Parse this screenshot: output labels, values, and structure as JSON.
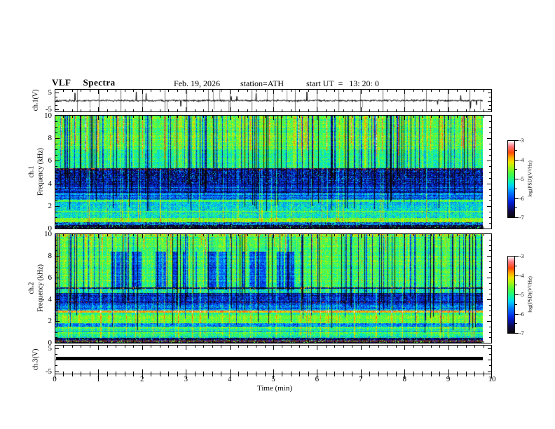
{
  "header": {
    "title": "VLF  Spectra",
    "date": "Feb. 19, 2026",
    "station": "station=ATH",
    "start_ut": "start UT  =   13: 20: 0"
  },
  "axes": {
    "time": {
      "label": "Time  (min)",
      "range_min": [
        0,
        10
      ],
      "tick_labels": [
        "0",
        "1",
        "2",
        "3",
        "4",
        "5",
        "6",
        "7",
        "8",
        "9",
        "10"
      ],
      "minor_step_min": 0.2
    },
    "frequency": {
      "unit": "kHz",
      "range_khz": [
        0,
        10
      ],
      "tick_values": [
        10,
        8,
        6,
        4,
        2,
        0
      ],
      "tick_labels": [
        "10",
        "8",
        "6",
        "4",
        "2",
        "0"
      ],
      "minor_step_khz": 0.5
    },
    "voltage": {
      "unit": "V",
      "tick_labels_top_bottom": [
        "5",
        "-5"
      ]
    }
  },
  "panels": {
    "ch1_wave": {
      "ylabel": "ch.1(V)"
    },
    "ch1_spec": {
      "ylabel_channel": "ch.1",
      "ylabel_axis": "Frequency  (kHz)"
    },
    "ch2_spec": {
      "ylabel_channel": "ch.2",
      "ylabel_axis": "Frequency  (kHz)"
    },
    "ch3_wave": {
      "ylabel": "ch.3(V)"
    }
  },
  "colorbar": {
    "label": "log(PSD)(V²/Hz)",
    "tick_labels": [
      "-3",
      "-4",
      "-5",
      "-6",
      "-7"
    ],
    "scale_range_logpsd": [
      -7,
      -3
    ]
  },
  "colormap": {
    "description": "rainbow PSD scale, t=0 maps to -7 (black) and t=1 maps to -3 (white)",
    "stops": [
      [
        0.0,
        [
          8,
          8,
          8
        ]
      ],
      [
        0.08,
        [
          15,
          8,
          70
        ]
      ],
      [
        0.2,
        [
          0,
          30,
          220
        ]
      ],
      [
        0.32,
        [
          0,
          120,
          255
        ]
      ],
      [
        0.4,
        [
          0,
          200,
          255
        ]
      ],
      [
        0.45,
        [
          0,
          235,
          200
        ]
      ],
      [
        0.52,
        [
          40,
          250,
          110
        ]
      ],
      [
        0.58,
        [
          80,
          250,
          60
        ]
      ],
      [
        0.65,
        [
          160,
          245,
          20
        ]
      ],
      [
        0.72,
        [
          235,
          230,
          0
        ]
      ],
      [
        0.78,
        [
          255,
          170,
          0
        ]
      ],
      [
        0.85,
        [
          255,
          70,
          10
        ]
      ],
      [
        0.93,
        [
          255,
          120,
          130
        ]
      ],
      [
        1.0,
        [
          255,
          255,
          255
        ]
      ]
    ]
  },
  "chart_data": [
    {
      "id": "ch1_waveform",
      "type": "line",
      "panel": "ch.1 (V)",
      "x_range_min": [
        0,
        9.8
      ],
      "y_axis_range_V": [
        -5,
        5
      ],
      "baseline_V": 0,
      "noise_sigma_V": 0.4,
      "spike_probability": 0.03,
      "spike_amplitude_V": [
        2,
        5
      ],
      "gray_spike_probability": 0.012,
      "grid_interval_min": 0.5,
      "seed": 5
    },
    {
      "id": "ch1_spectrogram",
      "type": "heatmap",
      "panel": "ch.1 Frequency (kHz)",
      "x_range_min": [
        0,
        9.8
      ],
      "f_max": 10,
      "seed": 11,
      "bands": [
        {
          "f": [
            0.0,
            0.3
          ],
          "t": 0.04,
          "noise": 0.05,
          "speckle": [
            0.1,
            0.55
          ]
        },
        {
          "f": [
            0.3,
            0.55
          ],
          "t": 0.3,
          "noise": 0.22
        },
        {
          "f": [
            0.55,
            0.95
          ],
          "t": 0.63,
          "noise": 0.07,
          "row_noise": 0.04
        },
        {
          "f": [
            0.95,
            1.4
          ],
          "t": 0.44,
          "noise": 0.12
        },
        {
          "f": [
            1.4,
            1.55
          ],
          "t": 0.58,
          "noise": 0.06
        },
        {
          "f": [
            1.55,
            2.35
          ],
          "t": 0.42,
          "noise": 0.12
        },
        {
          "f": [
            2.35,
            2.55
          ],
          "t": 0.57,
          "noise": 0.06
        },
        {
          "f": [
            2.55,
            3.1
          ],
          "t": 0.36,
          "noise": 0.12,
          "stripes": [
            0.3,
            -0.12
          ]
        },
        {
          "f": [
            3.1,
            4.0
          ],
          "t": 0.26,
          "noise": 0.12,
          "stripes": [
            0.35,
            -0.14
          ],
          "row_noise": 0.08
        },
        {
          "f": [
            4.0,
            5.15
          ],
          "t": 0.16,
          "noise": 0.14,
          "row_noise": 0.06,
          "speckle": [
            0.04,
            0.42
          ]
        },
        {
          "f": [
            5.15,
            5.35
          ],
          "t": 0.1,
          "noise": 0.08,
          "speckle": [
            0.12,
            0.85
          ]
        },
        {
          "f": [
            5.35,
            7.0
          ],
          "t": 0.5,
          "noise": 0.1
        },
        {
          "f": [
            7.0,
            10.0
          ],
          "t": 0.58,
          "noise": 0.1,
          "row_noise": 0.05
        }
      ],
      "streaks": [
        {
          "name": "black",
          "prob": 0.11,
          "delta": -0.45,
          "f_lo": 1.5,
          "jitter": 3.5,
          "f_hi": 10
        },
        {
          "name": "navy",
          "prob": 0.07,
          "delta": -0.26,
          "f_lo": 2.8,
          "jitter": 2.0,
          "f_hi": 10
        },
        {
          "name": "cyan",
          "prob": 0.06,
          "delta": 0.2,
          "f_lo": 0.6,
          "jitter": 0,
          "f_hi": 5.3
        },
        {
          "name": "yellow-green",
          "prob": 0.09,
          "delta": 0.13,
          "f_lo": 5.2,
          "jitter": 0,
          "f_hi": 10
        },
        {
          "name": "orange-red",
          "prob": 0.05,
          "delta": 0.28,
          "f_lo": 6.2,
          "jitter": 1.5,
          "f_hi": 10
        }
      ]
    },
    {
      "id": "ch2_spectrogram",
      "type": "heatmap",
      "panel": "ch.2 Frequency (kHz)",
      "x_range_min": [
        0,
        9.8
      ],
      "f_max": 10,
      "seed": 23,
      "bands": [
        {
          "f": [
            0.0,
            0.1
          ],
          "t": 0.05,
          "noise": 0.05,
          "speckle": [
            0.1,
            0.55
          ]
        },
        {
          "f": [
            0.1,
            0.22
          ],
          "t": 0.8,
          "noise": 0.08
        },
        {
          "f": [
            0.22,
            0.42
          ],
          "t": 0.08,
          "noise": 0.1,
          "speckle": [
            0.06,
            0.5
          ]
        },
        {
          "f": [
            0.42,
            0.65
          ],
          "t": 0.47,
          "noise": 0.15
        },
        {
          "f": [
            0.65,
            1.5
          ],
          "t": 0.54,
          "noise": 0.1,
          "stripes": [
            0.25,
            -0.14
          ],
          "row_noise": 0.06
        },
        {
          "f": [
            1.5,
            1.78
          ],
          "t": 0.33,
          "noise": 0.14,
          "stripes": [
            0.3,
            -0.12
          ]
        },
        {
          "f": [
            1.78,
            2.55
          ],
          "t": 0.6,
          "noise": 0.08,
          "stripes": [
            0.15,
            0.1
          ],
          "row_noise": 0.05
        },
        {
          "f": [
            2.55,
            2.78
          ],
          "t": 0.5,
          "noise": 0.1
        },
        {
          "f": [
            2.78,
            2.95
          ],
          "t": 0.77,
          "noise": 0.07
        },
        {
          "f": [
            2.95,
            3.65
          ],
          "t": 0.33,
          "noise": 0.13,
          "stripes": [
            0.3,
            -0.12
          ]
        },
        {
          "f": [
            3.65,
            3.82
          ],
          "t": 0.14,
          "noise": 0.1,
          "speckle": [
            0.05,
            0.85
          ]
        },
        {
          "f": [
            3.82,
            4.6
          ],
          "t": 0.23,
          "noise": 0.13,
          "stripes": [
            0.3,
            -0.1
          ]
        },
        {
          "f": [
            4.6,
            4.95
          ],
          "t": 0.48,
          "noise": 0.12
        },
        {
          "f": [
            4.95,
            5.12
          ],
          "t": 0.1,
          "noise": 0.08,
          "speckle": [
            0.08,
            0.8
          ]
        },
        {
          "f": [
            5.12,
            9.75
          ],
          "t": 0.55,
          "noise": 0.1,
          "row_noise": 0.05
        },
        {
          "f": [
            9.75,
            10.0
          ],
          "t": 0.62,
          "noise": 0.14,
          "speckle": [
            0.06,
            0.8
          ]
        }
      ],
      "streaks": [
        {
          "name": "black",
          "prob": 0.09,
          "delta": -0.45,
          "f_lo": 0.8,
          "jitter": 3.5,
          "f_hi": 10
        },
        {
          "name": "navy",
          "prob": 0.05,
          "delta": -0.25,
          "f_lo": 3.0,
          "jitter": 2.0,
          "f_hi": 10
        },
        {
          "name": "cyan",
          "prob": 0.06,
          "delta": 0.18,
          "f_lo": 0.4,
          "jitter": 0,
          "f_hi": 5.2
        },
        {
          "name": "yellow-green",
          "prob": 0.06,
          "delta": 0.12,
          "f_lo": 5.0,
          "jitter": 0,
          "f_hi": 10
        },
        {
          "name": "orange-red",
          "prob": 0.02,
          "delta": 0.26,
          "f_lo": 8.0,
          "jitter": 1.0,
          "f_hi": 10
        }
      ],
      "patches": [
        {
          "f": [
            4.9,
            8.4
          ],
          "x": [
            0.12,
            0.58
          ],
          "delta": -0.26,
          "on": 0.06,
          "off": 0.12
        }
      ]
    },
    {
      "id": "ch3_waveform",
      "type": "line",
      "panel": "ch.3 (V)",
      "x_range_min": [
        0,
        9.8
      ],
      "y_axis_range_V": [
        -5,
        5
      ],
      "flat": true,
      "value_V": 0,
      "line_thickness_px": 5
    }
  ]
}
